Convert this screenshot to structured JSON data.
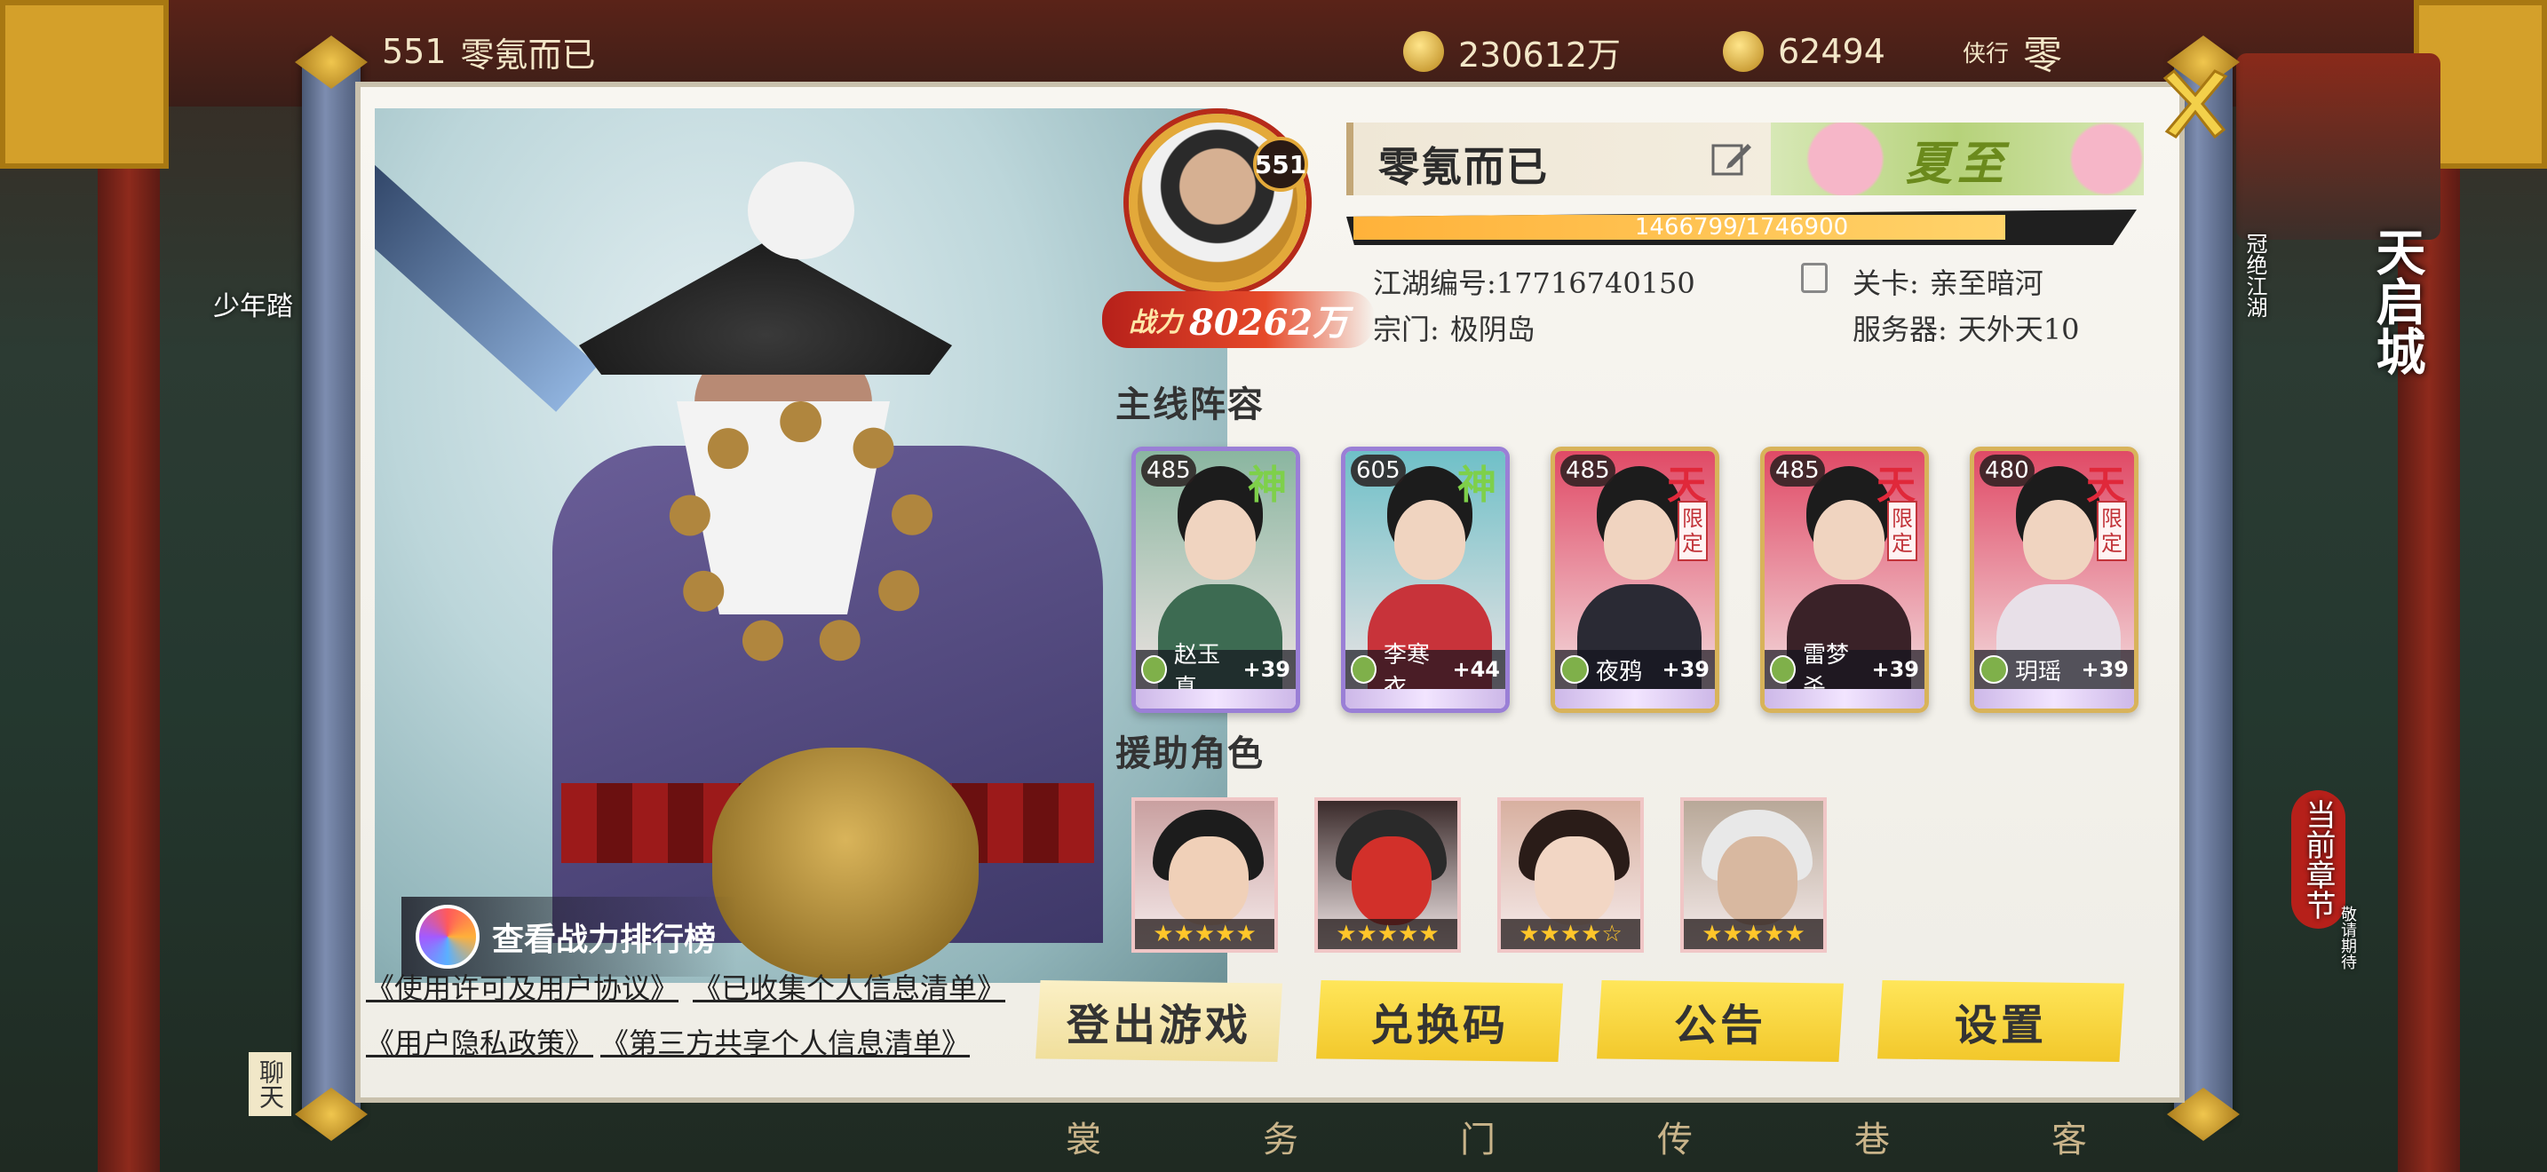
{
  "background": {
    "hud": {
      "level_tag": "551",
      "player_name_tag": "零氪而已",
      "silver": "230612万",
      "gold": "62494",
      "xiake_tag": "侠行",
      "xiake_tag2": "零"
    },
    "left_labels": {
      "event": "少年踏",
      "chat": "聊天"
    },
    "right": {
      "city": "天启城",
      "guild": "冠绝江湖",
      "chapter": "当前章节",
      "chapter_sub": "敬请期待"
    },
    "bottom_nav": [
      "裳",
      "务",
      "门",
      "传",
      "巷",
      "客"
    ]
  },
  "profile": {
    "level": "551",
    "power_label": "战力",
    "power_value": "80262万",
    "name": "零氪而已",
    "title_badge": "夏至",
    "exp_text": "1466799/1746900",
    "exp_current": 1466799,
    "exp_max": 1746900,
    "jianghu_id_label": "江湖编号:",
    "jianghu_id": "17716740150",
    "stage_label": "关卡:",
    "stage": "亲至暗河",
    "sect_label": "宗门:",
    "sect": "极阴岛",
    "server_label": "服务器:",
    "server": "天外天10"
  },
  "rank_button": "查看战力排行榜",
  "main_lineup": {
    "title": "主线阵容",
    "heroes": [
      {
        "level": "485",
        "grade": "神",
        "name": "赵玉真",
        "plus": "+39",
        "limited": "",
        "bg": "#8ab6a0",
        "robe": "#3d6b52",
        "frame": "#9a7fd6"
      },
      {
        "level": "605",
        "grade": "神",
        "name": "李寒衣",
        "plus": "+44",
        "limited": "",
        "bg": "#6fc0c8",
        "robe": "#c8333a",
        "frame": "#9a7fd6"
      },
      {
        "level": "485",
        "grade": "天",
        "name": "夜鸦",
        "plus": "+39",
        "limited": "限定",
        "bg": "#e04a66",
        "robe": "#2a2a34",
        "frame": "#d8b35a"
      },
      {
        "level": "485",
        "grade": "天",
        "name": "雷梦杀",
        "plus": "+39",
        "limited": "限定",
        "bg": "#e04a66",
        "robe": "#3a2228",
        "frame": "#d8b35a"
      },
      {
        "level": "480",
        "grade": "天",
        "name": "玥瑶",
        "plus": "+39",
        "limited": "限定",
        "bg": "#e04a66",
        "robe": "#e8e0e8",
        "frame": "#d8b35a"
      }
    ]
  },
  "support": {
    "title": "援助角色",
    "roles": [
      {
        "stars": "★★★★★",
        "bg": "#c9a0a0",
        "hair": "#1c1c1c",
        "face": "#f0d0b8"
      },
      {
        "stars": "★★★★★",
        "bg": "#3a2a2a",
        "hair": "#2a2a2a",
        "face": "#d2302a"
      },
      {
        "stars": "★★★★☆",
        "bg": "#d8b0a0",
        "hair": "#2a1c18",
        "face": "#f2d6c4"
      },
      {
        "stars": "★★★★★",
        "bg": "#b8a898",
        "hair": "#e8e8e8",
        "face": "#d8b8a0"
      }
    ]
  },
  "links": {
    "license": "《使用许可及用户协议》",
    "collected": "《已收集个人信息清单》",
    "privacy": "《用户隐私政策》",
    "third_party": "《第三方共享个人信息清单》"
  },
  "buttons": {
    "logout": "登出游戏",
    "redeem": "兑换码",
    "notice": "公告",
    "settings": "设置"
  },
  "colors": {
    "accent_gold": "#f2c72a",
    "power_red": "#b6201a",
    "exp_orange": "#ffb23a",
    "title_green": "#6b8a1c"
  }
}
